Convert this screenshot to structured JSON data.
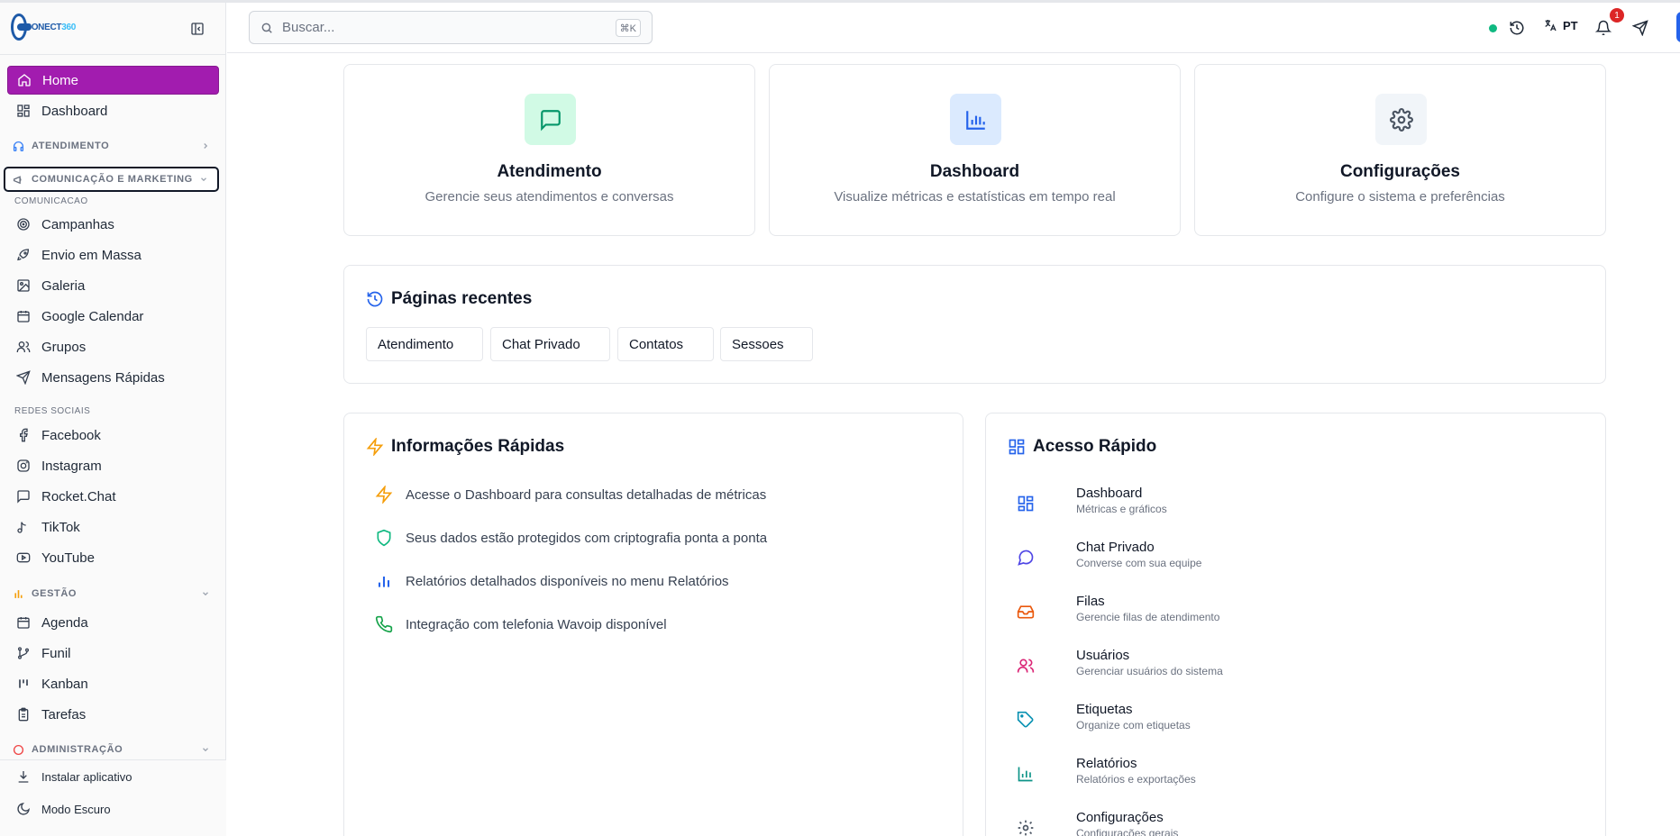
{
  "app": {
    "logo_text": "CONECT",
    "logo_suffix": "360"
  },
  "sidebar": {
    "home": "Home",
    "dashboard": "Dashboard",
    "section_atendimento": "ATENDIMENTO",
    "section_comunicacao": "COMUNICAÇÃO E MARKETING",
    "sub_comunicacao": "COMUNICACAO",
    "comunicacao_items": [
      "Campanhas",
      "Envio em Massa",
      "Galeria",
      "Google Calendar",
      "Grupos",
      "Mensagens Rápidas"
    ],
    "sub_redes": "REDES SOCIAIS",
    "redes_items": [
      "Facebook",
      "Instagram",
      "Rocket.Chat",
      "TikTok",
      "YouTube"
    ],
    "section_gestao": "GESTÃO",
    "gestao_items": [
      "Agenda",
      "Funil",
      "Kanban",
      "Tarefas"
    ],
    "section_admin": "ADMINISTRAÇÃO",
    "install_app": "Instalar aplicativo",
    "dark_mode": "Modo Escuro"
  },
  "header": {
    "search_placeholder": "Buscar...",
    "shortcut": "⌘K",
    "language": "PT",
    "notification_count": "1"
  },
  "features": [
    {
      "title": "Atendimento",
      "desc": "Gerencie seus atendimentos e conversas",
      "icon": "message-square-icon",
      "color": "#059669",
      "bg": "#d1fae5"
    },
    {
      "title": "Dashboard",
      "desc": "Visualize métricas e estatísticas em tempo real",
      "icon": "bar-chart-icon",
      "color": "#2563eb",
      "bg": "#dbeafe"
    },
    {
      "title": "Configurações",
      "desc": "Configure o sistema e preferências",
      "icon": "settings-icon",
      "color": "#4b5563",
      "bg": "#f1f5f9"
    }
  ],
  "recent": {
    "title": "Páginas recentes",
    "chips": [
      "Atendimento",
      "Chat Privado",
      "Contatos",
      "Sessoes"
    ]
  },
  "info": {
    "title": "Informações Rápidas",
    "items": [
      "Acesse o Dashboard para consultas detalhadas de métricas",
      "Seus dados estão protegidos com criptografia ponta a ponta",
      "Relatórios detalhados disponíveis no menu Relatórios",
      "Integração com telefonia Wavoip disponível"
    ]
  },
  "quick": {
    "title": "Acesso Rápido",
    "items": [
      {
        "title": "Dashboard",
        "sub": "Métricas e gráficos",
        "color": "#2563eb"
      },
      {
        "title": "Chat Privado",
        "sub": "Converse com sua equipe",
        "color": "#4f46e5"
      },
      {
        "title": "Filas",
        "sub": "Gerencie filas de atendimento",
        "color": "#ea580c"
      },
      {
        "title": "Usuários",
        "sub": "Gerenciar usuários do sistema",
        "color": "#db2777"
      },
      {
        "title": "Etiquetas",
        "sub": "Organize com etiquetas",
        "color": "#0891b2"
      },
      {
        "title": "Relatórios",
        "sub": "Relatórios e exportações",
        "color": "#0d9488"
      },
      {
        "title": "Configurações",
        "sub": "Configurações gerais",
        "color": "#4b5563"
      }
    ]
  }
}
